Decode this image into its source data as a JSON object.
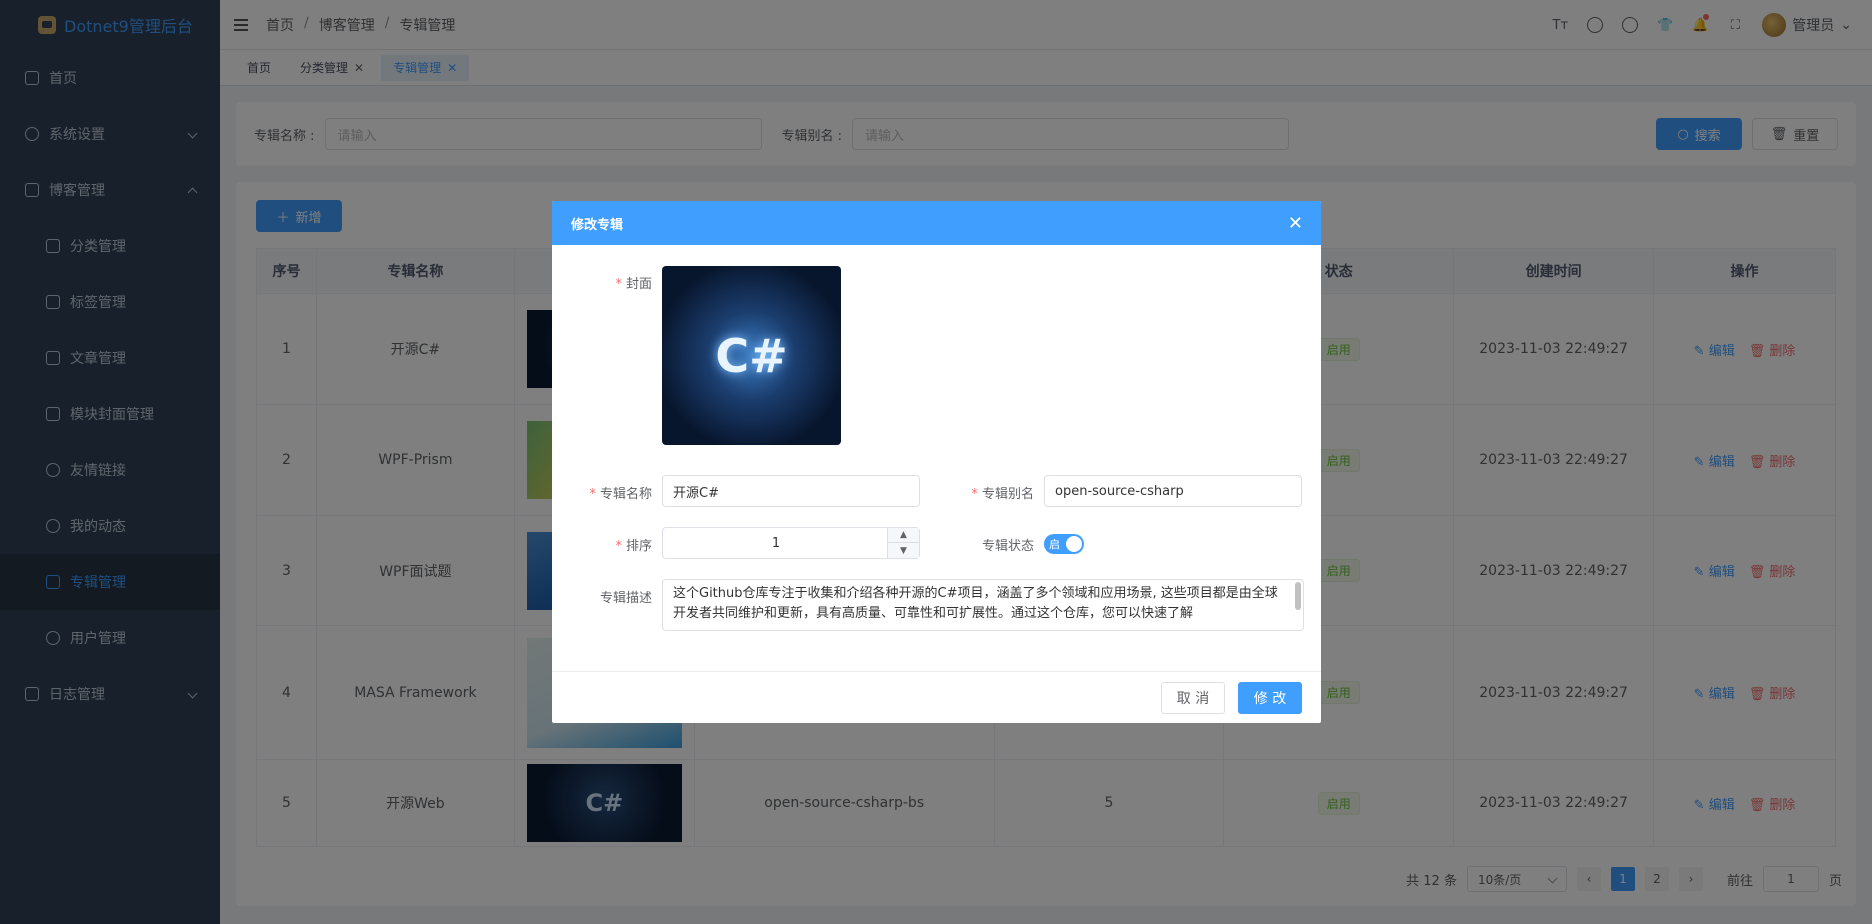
{
  "app": {
    "logo_text": "Dotnet9管理后台"
  },
  "sidebar": {
    "items": [
      {
        "label": "首页",
        "icon": "home-icon"
      },
      {
        "label": "系统设置",
        "icon": "gear-icon"
      },
      {
        "label": "博客管理",
        "icon": "blog-icon"
      },
      {
        "label": "分类管理",
        "icon": "grid-icon"
      },
      {
        "label": "标签管理",
        "icon": "tag-icon"
      },
      {
        "label": "文章管理",
        "icon": "document-icon"
      },
      {
        "label": "模块封面管理",
        "icon": "image-icon"
      },
      {
        "label": "友情链接",
        "icon": "link-icon"
      },
      {
        "label": "我的动态",
        "icon": "chat-icon"
      },
      {
        "label": "专辑管理",
        "icon": "grid-icon"
      },
      {
        "label": "用户管理",
        "icon": "user-icon"
      },
      {
        "label": "日志管理",
        "icon": "log-icon"
      }
    ]
  },
  "header": {
    "breadcrumb": [
      "首页",
      "博客管理",
      "专辑管理"
    ],
    "breadcrumb_sep": "/",
    "user_name": "管理员"
  },
  "tags": [
    {
      "label": "首页",
      "closable": false
    },
    {
      "label": "分类管理",
      "closable": true
    },
    {
      "label": "专辑管理",
      "closable": true,
      "active": true
    }
  ],
  "search": {
    "name_label": "专辑名称 :",
    "name_placeholder": "请输入",
    "alias_label": "专辑别名 :",
    "alias_placeholder": "请输入",
    "search_btn": "搜索",
    "reset_btn": "重置"
  },
  "table": {
    "add_btn": "新增",
    "columns": [
      "序号",
      "专辑名称",
      "",
      "",
      "",
      "状态",
      "创建时间",
      "操作"
    ],
    "rows": [
      {
        "no": "1",
        "name": "开源C#",
        "alias": "",
        "sort": "",
        "status": "启用",
        "created": "2023-11-03 22:49:27"
      },
      {
        "no": "2",
        "name": "WPF-Prism",
        "alias": "",
        "sort": "",
        "status": "启用",
        "created": "2023-11-03 22:49:27"
      },
      {
        "no": "3",
        "name": "WPF面试题",
        "alias": "",
        "sort": "",
        "status": "启用",
        "created": "2023-11-03 22:49:27"
      },
      {
        "no": "4",
        "name": "MASA Framework",
        "alias": "",
        "sort": "",
        "status": "启用",
        "created": "2023-11-03 22:49:27"
      },
      {
        "no": "5",
        "name": "开源Web",
        "alias": "open-source-csharp-bs",
        "sort": "5",
        "status": "启用",
        "created": "2023-11-03 22:49:27"
      }
    ],
    "edit_label": "编辑",
    "delete_label": "删除"
  },
  "pagination": {
    "total": "共 12 条",
    "page_size": "10条/页",
    "pages": [
      "1",
      "2"
    ],
    "goto_label": "前往",
    "goto_value": "1",
    "page_suffix": "页"
  },
  "dialog": {
    "title": "修改专辑",
    "cover_label": "封面",
    "cover_text": "C#",
    "name_label": "专辑名称",
    "name_value": "开源C#",
    "alias_label": "专辑别名",
    "alias_value": "open-source-csharp",
    "sort_label": "排序",
    "sort_value": "1",
    "status_label": "专辑状态",
    "status_value": "启",
    "desc_label": "专辑描述",
    "desc_value": "这个Github仓库专注于收集和介绍各种开源的C#项目，涵盖了多个领域和应用场景, 这些项目都是由全球开发者共同维护和更新，具有高质量、可靠性和可扩展性。通过这个仓库，您可以快速了解",
    "cancel_btn": "取 消",
    "ok_btn": "修 改"
  },
  "colors": {
    "primary": "#409eff",
    "sidebar_bg": "#304156",
    "danger": "#f56c6c",
    "success": "#67c23a"
  }
}
